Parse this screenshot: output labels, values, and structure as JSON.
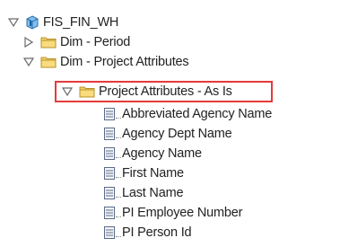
{
  "tree": {
    "root": {
      "label": "FIS_FIN_WH",
      "icon": "database-cube-icon",
      "expanded": true
    },
    "folders": [
      {
        "label": "Dim - Period",
        "icon": "folder-icon",
        "expanded": false
      },
      {
        "label": "Dim - Project Attributes",
        "icon": "folder-icon",
        "expanded": true
      },
      {
        "label": "Project Attributes - As Is",
        "icon": "folder-icon",
        "expanded": true,
        "highlighted": true
      }
    ],
    "columns": [
      {
        "label": "Abbreviated Agency Name",
        "icon": "column-icon"
      },
      {
        "label": "Agency Dept Name",
        "icon": "column-icon"
      },
      {
        "label": "Agency Name",
        "icon": "column-icon"
      },
      {
        "label": "First Name",
        "icon": "column-icon"
      },
      {
        "label": "Last Name",
        "icon": "column-icon"
      },
      {
        "label": "PI Employee Number",
        "icon": "column-icon"
      },
      {
        "label": "PI Person Id",
        "icon": "column-icon"
      }
    ]
  },
  "colors": {
    "highlight_border": "#e53a3a",
    "folder": "#f2c94c",
    "cube": "#3a8fd6",
    "column_icon": "#5a6b8a"
  }
}
